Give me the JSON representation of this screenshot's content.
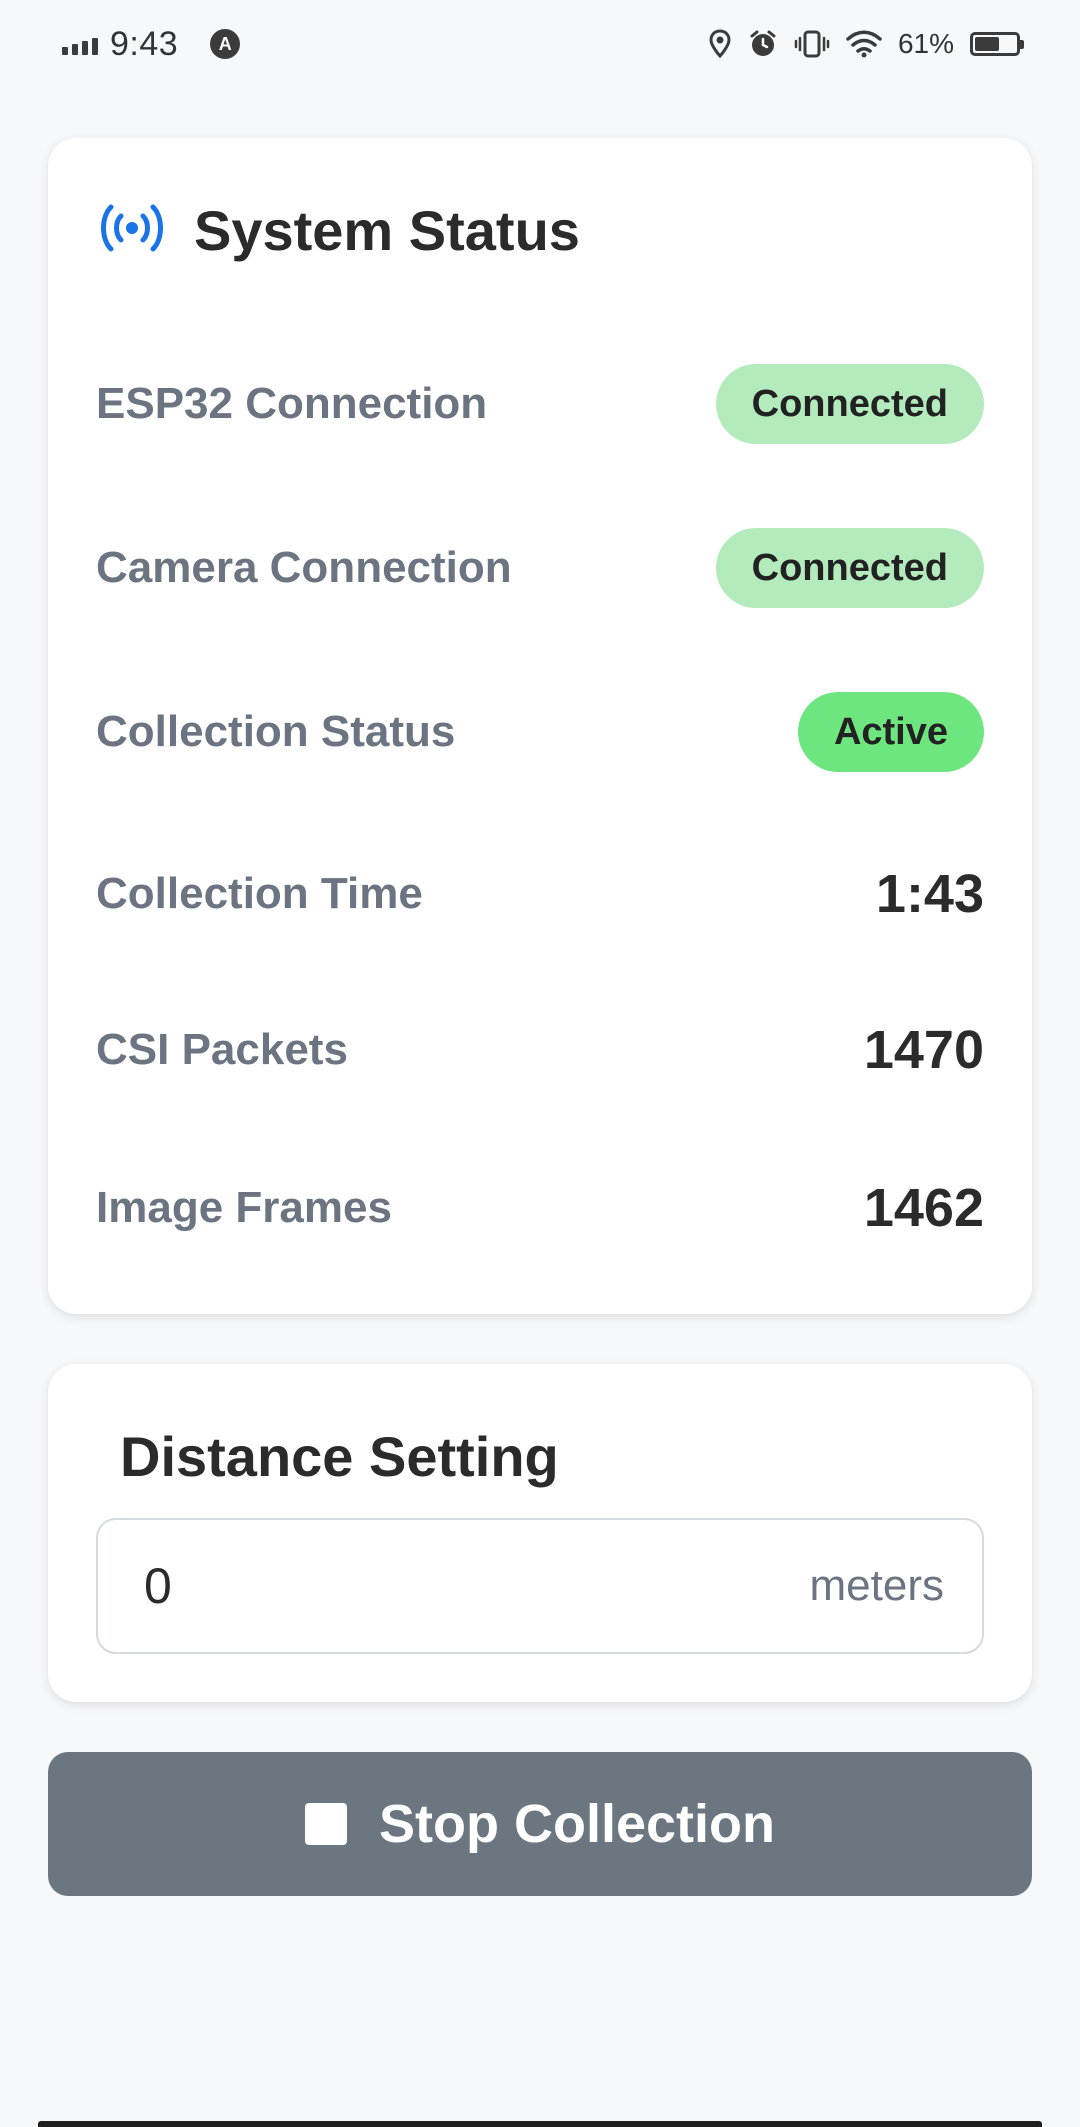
{
  "status_bar": {
    "time": "9:43",
    "app_badge": "A",
    "battery_text": "61%",
    "battery_level": 0.61,
    "icons": [
      "signal-icon",
      "location-icon",
      "alarm-icon",
      "vibrate-icon",
      "wifi-icon",
      "battery-icon"
    ]
  },
  "system_status": {
    "title": "System Status",
    "icon": "wireless-broadcast-icon",
    "accent_color": "#1a73e8",
    "rows": [
      {
        "label": "ESP32 Connection",
        "badge": "Connected",
        "badge_color": "#b3ebbd"
      },
      {
        "label": "Camera Connection",
        "badge": "Connected",
        "badge_color": "#b3ebbd"
      },
      {
        "label": "Collection Status",
        "badge": "Active",
        "badge_color": "#6ee67f"
      },
      {
        "label": "Collection Time",
        "value": "1:43"
      },
      {
        "label": "CSI Packets",
        "value": "1470"
      },
      {
        "label": "Image Frames",
        "value": "1462"
      }
    ]
  },
  "distance": {
    "title": "Distance Setting",
    "value": "0",
    "unit": "meters"
  },
  "stop_button": {
    "label": "Stop Collection",
    "icon": "stop-icon",
    "color": "#6c7681"
  }
}
